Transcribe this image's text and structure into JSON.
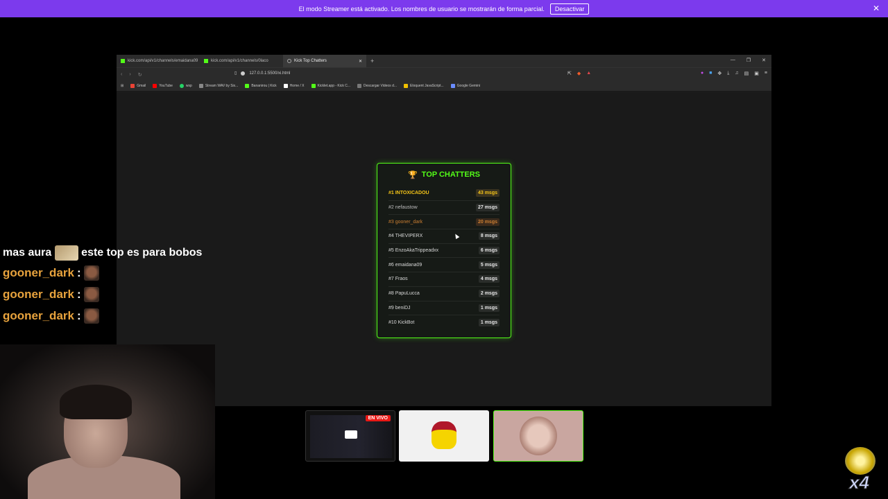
{
  "banner": {
    "text": "El modo Streamer está activado. Los nombres de usuario se mostrarán de forma parcial.",
    "button": "Desactivar",
    "close": "✕"
  },
  "browser": {
    "tabs": [
      {
        "title": "kick.com/api/v1/channels/emaidana09",
        "icon": "kick-favicon"
      },
      {
        "title": "kick.com/api/v1/channels/0laco",
        "icon": "kick-favicon"
      },
      {
        "title": "Kick Top Chatters",
        "icon": "globe-icon"
      }
    ],
    "url": "127.0.0.1:5500/xi.html",
    "bookmarks": [
      "Gmail",
      "YouTube",
      "wsp",
      "Stream WAV by Six...",
      "Bananirou | Kick",
      "Home / X",
      "Kicklet.app - Kick C...",
      "Descargar Videos d...",
      "Eloquent JavaScript...",
      "Google Gemini"
    ]
  },
  "card": {
    "title": "TOP CHATTERS",
    "rows": [
      {
        "rank": "#1 INTOXICADOU",
        "msgs": "43 msgs"
      },
      {
        "rank": "#2 nefaustow",
        "msgs": "27 msgs"
      },
      {
        "rank": "#3 gooner_dark",
        "msgs": "20 msgs"
      },
      {
        "rank": "#4 THEVIPERX",
        "msgs": "8 msgs"
      },
      {
        "rank": "#5 EnzoAkaTrippeadxx",
        "msgs": "6 msgs"
      },
      {
        "rank": "#6 emaidana09",
        "msgs": "5 msgs"
      },
      {
        "rank": "#7 Fraos",
        "msgs": "4 msgs"
      },
      {
        "rank": "#8 PapuLucca",
        "msgs": "2 msgs"
      },
      {
        "rank": "#9 beniDJ",
        "msgs": "1 msgs"
      },
      {
        "rank": "#10 KickBot",
        "msgs": "1 msgs"
      }
    ]
  },
  "chat": {
    "first_a": "mas aura",
    "first_b": "este top es para bobos",
    "lines": [
      {
        "user": "gooner_dark",
        "sep": ":"
      },
      {
        "user": "gooner_dark",
        "sep": ":"
      },
      {
        "user": "gooner_dark",
        "sep": ":"
      }
    ]
  },
  "thumbs": {
    "live": "EN VIVO"
  },
  "badge": {
    "multiplier": "x4"
  },
  "colors": {
    "accent": "#53fc18",
    "banner": "#7c3aed",
    "gold": "#f5c518",
    "bronze": "#cd7f32",
    "chat_user": "#e8a33d"
  }
}
